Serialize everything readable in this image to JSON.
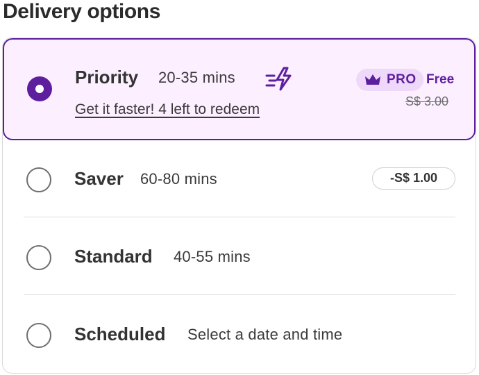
{
  "heading": "Delivery options",
  "options": [
    {
      "title": "Priority",
      "time": "20-35 mins",
      "selected": true,
      "promo_link": "Get it faster! 4 left to redeem",
      "badge": "PRO",
      "price": "Free",
      "original_price": "S$ 3.00",
      "icon": "lightning-bolt-icon"
    },
    {
      "title": "Saver",
      "time": "60-80 mins",
      "selected": false,
      "discount": "-S$ 1.00"
    },
    {
      "title": "Standard",
      "time": "40-55 mins",
      "selected": false
    },
    {
      "title": "Scheduled",
      "time": "Select a date and time",
      "selected": false
    }
  ],
  "colors": {
    "accent": "#5e1f9e",
    "selected_bg": "#fcefff",
    "badge_bg": "#efd9fb"
  }
}
